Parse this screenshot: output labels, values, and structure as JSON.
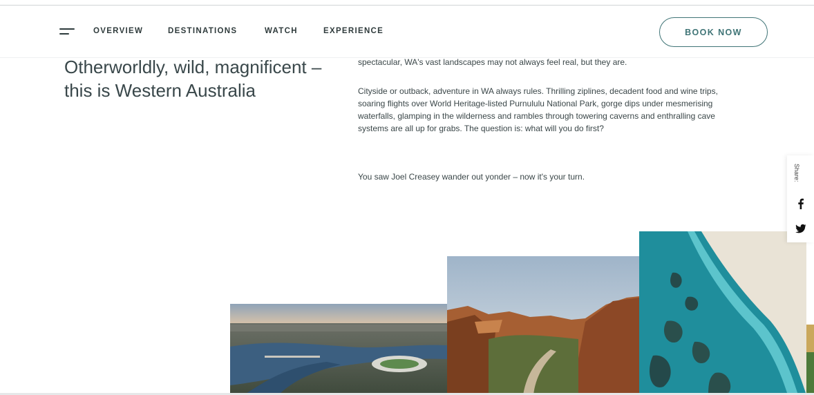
{
  "nav": {
    "menu_icon": "hamburger-menu-icon",
    "links": [
      "OVERVIEW",
      "DESTINATIONS",
      "WATCH",
      "EXPERIENCE"
    ],
    "book_now": "BOOK NOW"
  },
  "headline": "Otherworldly, wild, magnificent – this is Western Australia",
  "body": {
    "paragraphs": [
      "spectacular, WA's vast landscapes may not always feel real, but they are.",
      "Cityside or outback, adventure in WA always rules. Thrilling ziplines, decadent food and wine trips, soaring flights over World Heritage-listed Purnululu National Park, gorge dips under mesmerising waterfalls, glamping in the wilderness and rambles through towering caverns and enthralling cave systems are all up for grabs. The question is: what will you do first?",
      "You saw Joel Creasey wander out yonder – now it's your turn."
    ]
  },
  "share": {
    "label": "Share:",
    "icons": [
      "facebook-icon",
      "twitter-icon"
    ]
  },
  "colors": {
    "accent": "#3f7476",
    "text": "#2f3b3c"
  }
}
